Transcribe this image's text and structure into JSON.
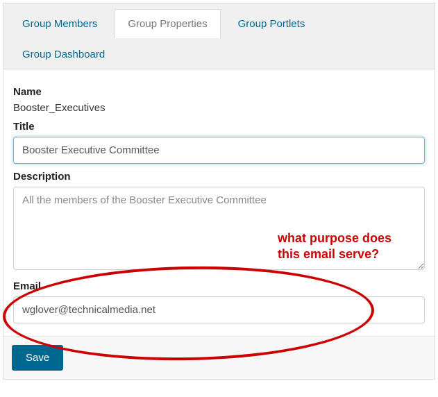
{
  "tabs": {
    "members": "Group Members",
    "properties": "Group Properties",
    "portlets": "Group Portlets",
    "dashboard": "Group Dashboard"
  },
  "form": {
    "name_label": "Name",
    "name_value": "Booster_Executives",
    "title_label": "Title",
    "title_value": "Booster Executive Committee",
    "description_label": "Description",
    "description_value": "All the members of the Booster Executive Committee",
    "email_label": "Email",
    "email_value": "wglover@technicalmedia.net"
  },
  "actions": {
    "save": "Save"
  },
  "annotation": {
    "text": "what purpose does this email serve?"
  }
}
